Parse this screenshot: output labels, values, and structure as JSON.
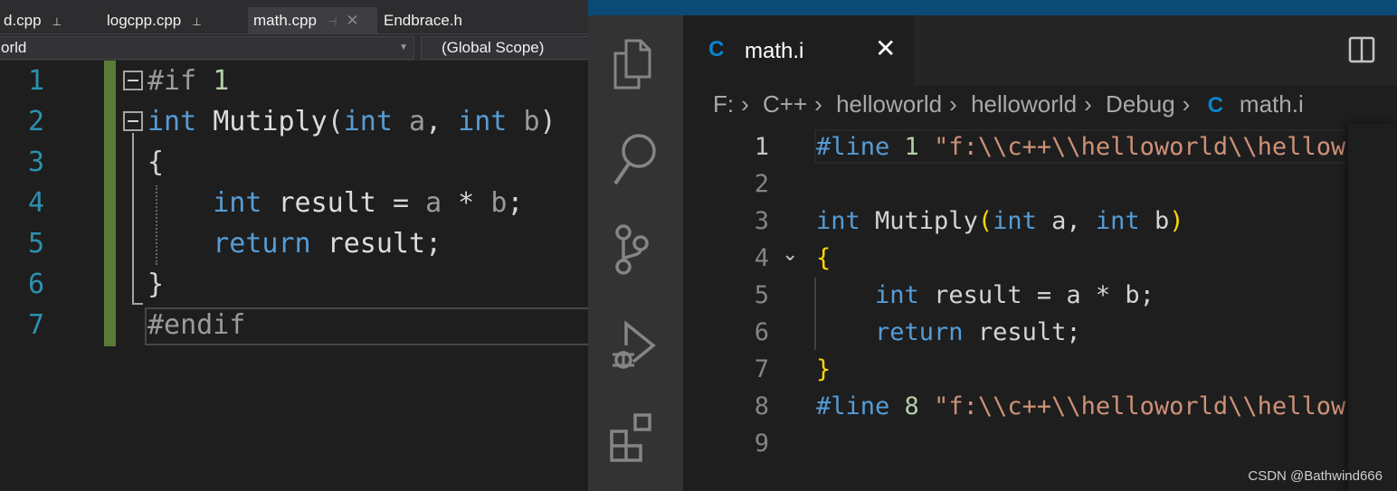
{
  "vs": {
    "tabs": [
      {
        "label": "d.cpp",
        "pinned": true
      },
      {
        "label": "logcpp.cpp",
        "pinned": true
      },
      {
        "label": "math.cpp",
        "active": true
      },
      {
        "label": "Endbrace.h"
      }
    ],
    "project_dropdown": "orld",
    "scope_dropdown": "(Global Scope)",
    "lines": [
      {
        "n": "1",
        "tokens": [
          [
            "p",
            "#if "
          ],
          [
            "n",
            "1"
          ]
        ]
      },
      {
        "n": "2",
        "tokens": [
          [
            "k",
            "int "
          ],
          [
            "t",
            "Mutiply"
          ],
          [
            "w",
            "("
          ],
          [
            "k",
            "int "
          ],
          [
            "v",
            "a"
          ],
          [
            "w",
            ", "
          ],
          [
            "k",
            "int "
          ],
          [
            "v",
            "b"
          ],
          [
            "w",
            ")"
          ]
        ]
      },
      {
        "n": "3",
        "tokens": [
          [
            "w",
            "{"
          ]
        ]
      },
      {
        "n": "4",
        "tokens": [
          [
            "w",
            "    "
          ],
          [
            "k",
            "int "
          ],
          [
            "t",
            "result "
          ],
          [
            "w",
            "= "
          ],
          [
            "v",
            "a"
          ],
          [
            "w",
            " * "
          ],
          [
            "v",
            "b"
          ],
          [
            "w",
            ";"
          ]
        ]
      },
      {
        "n": "5",
        "tokens": [
          [
            "w",
            "    "
          ],
          [
            "k",
            "return "
          ],
          [
            "t",
            "result"
          ],
          [
            "w",
            ";"
          ]
        ]
      },
      {
        "n": "6",
        "tokens": [
          [
            "w",
            "}"
          ]
        ]
      },
      {
        "n": "7",
        "tokens": [
          [
            "p",
            "#endif"
          ]
        ]
      }
    ]
  },
  "vscode": {
    "tab": {
      "label": "math.i",
      "icon": "C"
    },
    "breadcrumb": [
      "F:",
      "C++",
      "helloworld",
      "helloworld",
      "Debug",
      "math.i"
    ],
    "lines": [
      {
        "n": "1",
        "tokens": [
          [
            "k",
            "#line "
          ],
          [
            "n",
            "1 "
          ],
          [
            "s",
            "\"f:\\\\c++\\\\helloworld\\\\hellow"
          ]
        ]
      },
      {
        "n": "2",
        "tokens": []
      },
      {
        "n": "3",
        "tokens": [
          [
            "k",
            "int "
          ],
          [
            "w",
            "Mutiply"
          ],
          [
            "y",
            "("
          ],
          [
            "k",
            "int "
          ],
          [
            "w",
            "a, "
          ],
          [
            "k",
            "int "
          ],
          [
            "w",
            "b"
          ],
          [
            "y",
            ")"
          ]
        ]
      },
      {
        "n": "4",
        "tokens": [
          [
            "y",
            "{"
          ]
        ]
      },
      {
        "n": "5",
        "tokens": [
          [
            "w",
            "    "
          ],
          [
            "k",
            "int "
          ],
          [
            "w",
            "result = a * b;"
          ]
        ]
      },
      {
        "n": "6",
        "tokens": [
          [
            "w",
            "    "
          ],
          [
            "k",
            "return "
          ],
          [
            "w",
            "result;"
          ]
        ]
      },
      {
        "n": "7",
        "tokens": [
          [
            "y",
            "}"
          ]
        ]
      },
      {
        "n": "8",
        "tokens": [
          [
            "k",
            "#line "
          ],
          [
            "n",
            "8 "
          ],
          [
            "s",
            "\"f:\\\\c++\\\\helloworld\\\\hellow"
          ]
        ]
      },
      {
        "n": "9",
        "tokens": []
      }
    ]
  },
  "watermark": "CSDN @Bathwind666",
  "colors": {
    "keyword": "#569cd6",
    "string": "#ce9178",
    "number": "#b5cea8",
    "bracket": "#ffd700",
    "vs_line_number": "#2b91af",
    "vs_change_bar": "#5b7a35"
  }
}
